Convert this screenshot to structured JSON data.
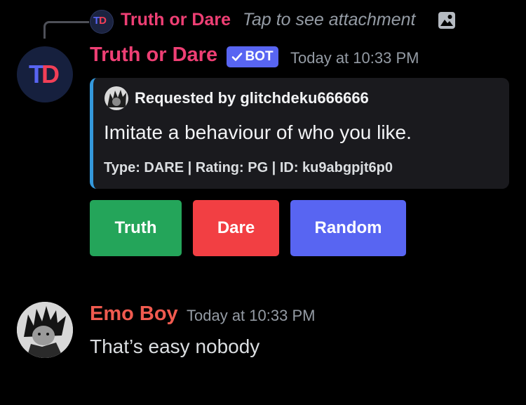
{
  "reply": {
    "author": "Truth or Dare",
    "text": "Tap to see attachment",
    "avatar_icon": "td-logo-icon",
    "attachment_icon": "image-icon"
  },
  "bot_message": {
    "author": "Truth or Dare",
    "badge": "BOT",
    "badge_icon": "verified-check-icon",
    "time": "Today at 10:33 PM",
    "avatar_icon": "td-logo-icon",
    "logo_t": "T",
    "logo_d": "D",
    "embed": {
      "accent_color": "#3498db",
      "author": "Requested by glitchdeku666666",
      "description": "Imitate a behaviour of who you like.",
      "footer": "Type: DARE | Rating: PG | ID: ku9abgpjt6p0"
    },
    "buttons": [
      {
        "label": "Truth",
        "color": "#24a55a"
      },
      {
        "label": "Dare",
        "color": "#f23f43"
      },
      {
        "label": "Random",
        "color": "#5865f2"
      }
    ]
  },
  "user_message": {
    "author": "Emo Boy",
    "author_color": "#f05a4f",
    "time": "Today at 10:33 PM",
    "text": "That’s easy nobody"
  },
  "colors": {
    "background": "#000000",
    "bot_name": "#ee3f74",
    "blurple": "#5865f2",
    "muted": "#949ba4"
  }
}
